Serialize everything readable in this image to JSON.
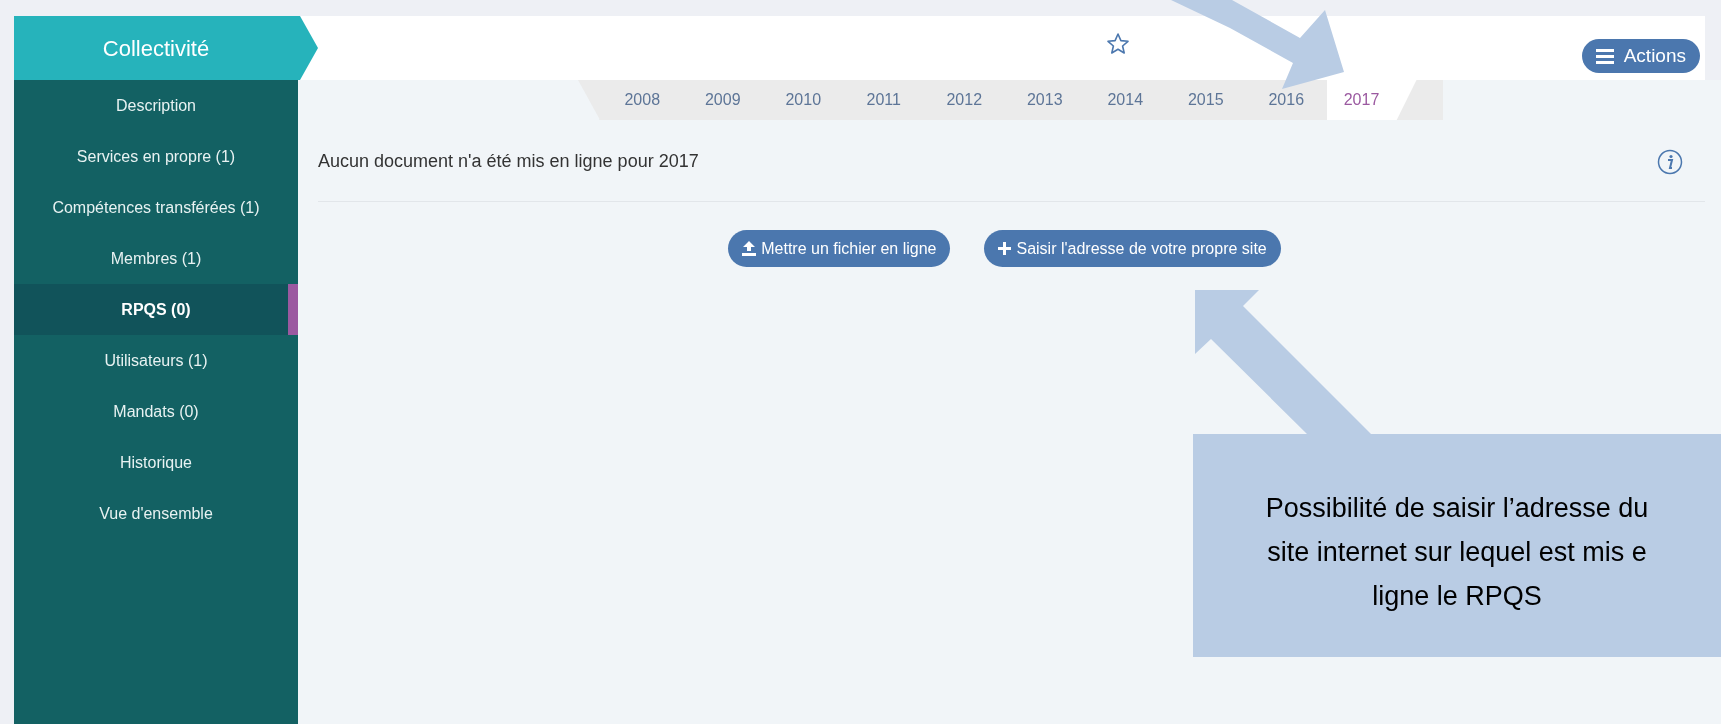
{
  "sidebar": {
    "title": "Collectivité",
    "items": [
      {
        "label": "Description",
        "selected": false
      },
      {
        "label": "Services en propre (1)",
        "selected": false
      },
      {
        "label": "Compétences transférées (1)",
        "selected": false
      },
      {
        "label": "Membres (1)",
        "selected": false
      },
      {
        "label": "RPQS (0)",
        "selected": true
      },
      {
        "label": "Utilisateurs (1)",
        "selected": false
      },
      {
        "label": "Mandats (0)",
        "selected": false
      },
      {
        "label": "Historique",
        "selected": false
      },
      {
        "label": "Vue d'ensemble",
        "selected": false
      }
    ]
  },
  "header": {
    "favorite": false,
    "actions_button": "Actions"
  },
  "year_tabs": [
    {
      "label": "2008",
      "selected": false
    },
    {
      "label": "2009",
      "selected": false
    },
    {
      "label": "2010",
      "selected": false
    },
    {
      "label": "2011",
      "selected": false
    },
    {
      "label": "2012",
      "selected": false
    },
    {
      "label": "2013",
      "selected": false
    },
    {
      "label": "2014",
      "selected": false
    },
    {
      "label": "2015",
      "selected": false
    },
    {
      "label": "2016",
      "selected": false
    },
    {
      "label": "2017",
      "selected": true
    }
  ],
  "content": {
    "message": "Aucun document n'a été mis en ligne pour 2017",
    "buttons": [
      {
        "kind": "upload",
        "label": "Mettre un fichier en ligne"
      },
      {
        "kind": "add",
        "label": "Saisir l'adresse de votre propre site"
      }
    ]
  },
  "annotation": {
    "lines": [
      "Possibilité de saisir l’adresse du",
      "site internet sur lequel est mis e",
      "ligne le RPQS"
    ]
  }
}
